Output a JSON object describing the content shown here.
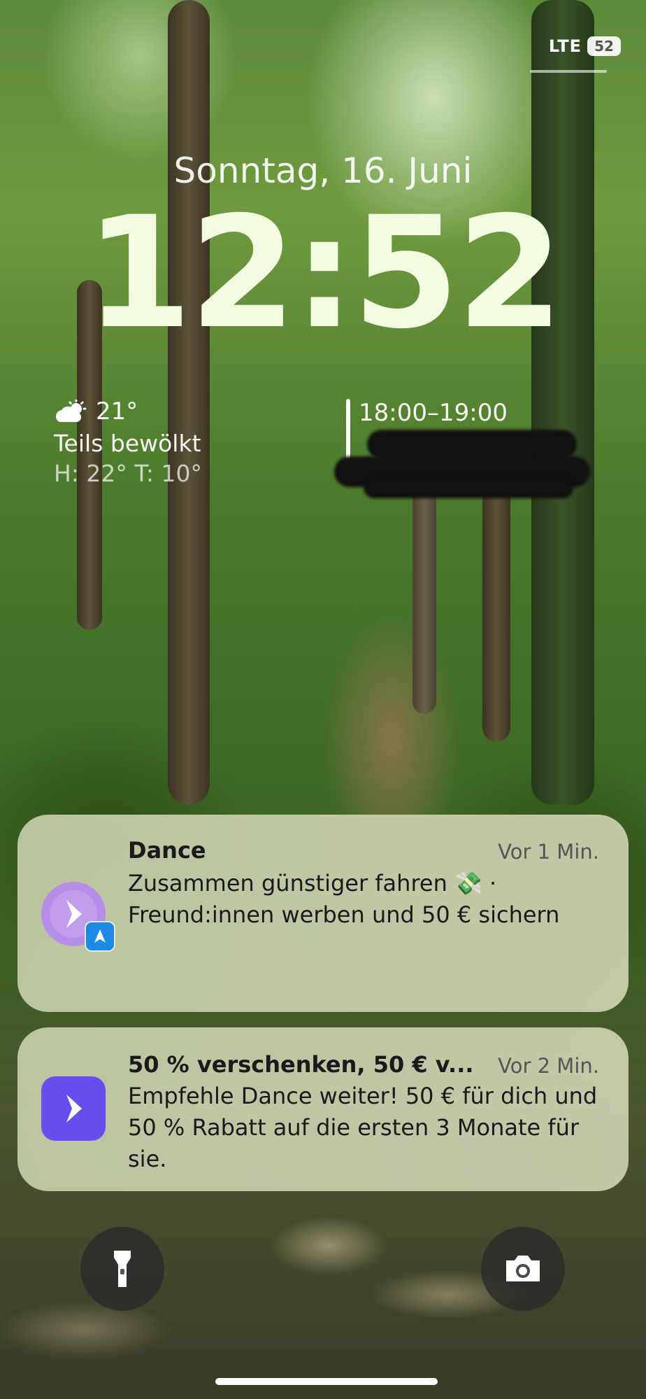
{
  "status_bar": {
    "network": "LTE",
    "battery": "52"
  },
  "lock_screen": {
    "date": "Sonntag, 16. Juni",
    "time": "12:52"
  },
  "weather_widget": {
    "icon": "partly-cloudy-sun-icon",
    "temperature": "21°",
    "condition": "Teils bewölkt",
    "high_low": "H: 22° T: 10°"
  },
  "calendar_widget": {
    "time_range": "18:00–19:00"
  },
  "notifications": [
    {
      "app": "Dance",
      "title": "Dance",
      "time_ago": "Vor 1 Min.",
      "body_line1": "Zusammen günstiger fahren",
      "emoji": "💸",
      "separator": "·",
      "body_line2": "Freund:innen werben und 50 € sichern"
    },
    {
      "app": "Dance",
      "title": "50 % verschenken, 50 € v...",
      "time_ago": "Vor 2 Min.",
      "body": "Empfehle Dance weiter! 50 € für dich und 50 % Rabatt auf die ersten 3 Monate für sie."
    }
  ],
  "quick_actions": {
    "left": "flashlight-icon",
    "right": "camera-icon"
  },
  "colors": {
    "dance_purple": "#6a4df0",
    "dance_light_purple": "#b58ee8",
    "badge_blue": "#1e88e5"
  }
}
